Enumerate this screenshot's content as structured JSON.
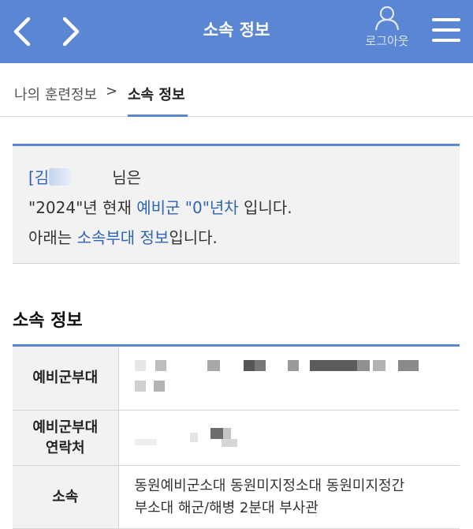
{
  "header": {
    "title": "소속 정보",
    "logout_label": "로그아웃",
    "icons": {
      "back": "chevron-left-icon",
      "forward": "chevron-right-icon",
      "user": "user-icon",
      "menu": "hamburger-menu-icon"
    }
  },
  "breadcrumb": {
    "home": "나의 훈련정보",
    "separator": ">",
    "current": "소속 정보"
  },
  "summary": {
    "name_prefix": "[김",
    "name_suffix": "님은",
    "year_quote": "\"2024\"년 현재 ",
    "reserve_label": "예비군 \"0\"년차",
    "sentence_end": " 입니다.",
    "line3_prefix": "아래는 ",
    "line3_highlight": "소속부대 정보",
    "line3_suffix": "입니다."
  },
  "section": {
    "title": "소속 정보"
  },
  "table": {
    "rows": [
      {
        "label": "예비군부대",
        "value": ""
      },
      {
        "label_line1": "예비군부대",
        "label_line2": "연락처",
        "value": ""
      },
      {
        "label": "소속",
        "value_line1": "동원예비군소대 동원미지정소대 동원미지정간",
        "value_line2": "부소대 해군/해병 2분대 부사관"
      }
    ]
  },
  "colors": {
    "header_bg": "#5b86d4",
    "accent_text": "#2f64b4",
    "box_bg": "#f2f2f2"
  }
}
